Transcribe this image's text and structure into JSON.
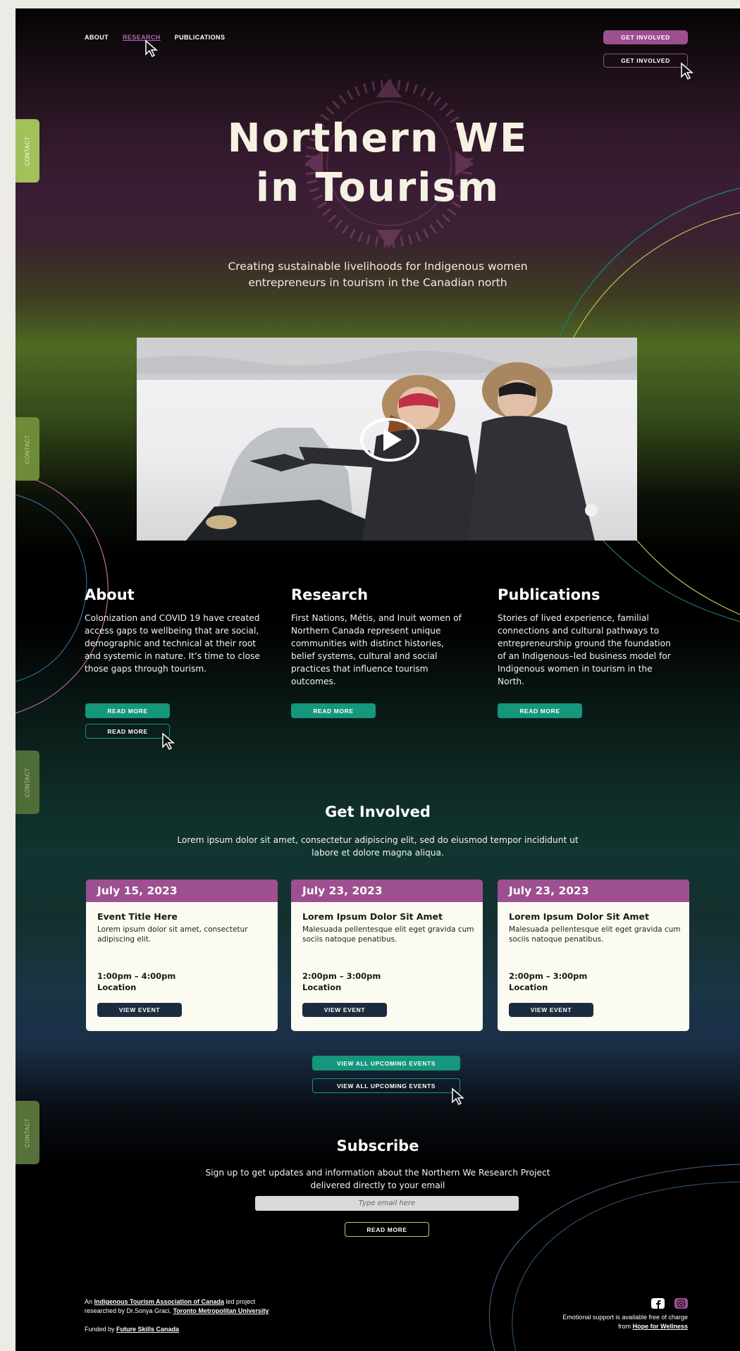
{
  "nav": {
    "items": [
      {
        "label": "ABOUT",
        "active": false
      },
      {
        "label": "RESEARCH",
        "active": true
      },
      {
        "label": "PUBLICATIONS",
        "active": false
      }
    ],
    "get_involved_label": "GET INVOLVED",
    "get_involved_outline_label": "GET INVOLVED"
  },
  "side_tabs": {
    "contact_1": "CONTACT",
    "contact_2": "CONTACT",
    "contact_3": "CONTACT",
    "contact_4": "CONTACT"
  },
  "hero": {
    "title_line1": "Northern WE",
    "title_line2": "in Tourism",
    "subtitle": "Creating sustainable livelihoods for Indigenous women entrepreneurs in tourism in the Canadian north"
  },
  "columns": [
    {
      "heading": "About",
      "text": "Colonization and COVID 19 have created access gaps to wellbeing that are social, demographic and technical at their root and systemic in nature. It’s time to close those gaps through tourism.",
      "button": "READ MORE",
      "button_outline": "READ MORE"
    },
    {
      "heading": "Research",
      "text": "First Nations, Métis, and Inuit women of Northern Canada represent unique communities with distinct histories, belief systems, cultural and social practices that influence tourism outcomes.",
      "button": "READ MORE"
    },
    {
      "heading": "Publications",
      "text": "Stories of lived experience, familial connections and cultural pathways to entrepreneurship ground the foundation of an Indigenous–led business model for Indigenous women in tourism in  the North.",
      "button": "READ MORE"
    }
  ],
  "get_involved": {
    "title": "Get Involved",
    "text": "Lorem ipsum dolor sit amet, consectetur adipiscing elit, sed do eiusmod tempor incididunt ut labore et dolore magna aliqua.",
    "events": [
      {
        "date": "July 15, 2023",
        "title": "Event Title Here",
        "desc": "Lorem ipsum dolor sit amet, consectetur adipiscing elit.",
        "time": "1:00pm – 4:00pm",
        "location": "Location",
        "button": "VIEW EVENT"
      },
      {
        "date": "July 23, 2023",
        "title": "Lorem Ipsum Dolor Sit Amet",
        "desc": "Malesuada pellentesque elit eget gravida cum sociis natoque penatibus.",
        "time": "2:00pm – 3:00pm",
        "location": "Location",
        "button": "VIEW EVENT"
      },
      {
        "date": "July 23, 2023",
        "title": "Lorem Ipsum Dolor Sit Amet",
        "desc": "Malesuada pellentesque elit eget gravida cum sociis natoque penatibus.",
        "time": "2:00pm – 3:00pm",
        "location": "Location",
        "button": "VIEW EVENT"
      }
    ],
    "view_all": "VIEW ALL UPCOMING EVENTS",
    "view_all_outline": "VIEW ALL UPCOMING EVENTS"
  },
  "subscribe": {
    "title": "Subscribe",
    "text": "Sign up to get updates and information about the Northern We Research Project delivered directly to your email",
    "placeholder": "Type email here",
    "button": "READ MORE"
  },
  "footer": {
    "line1_prefix": "An ",
    "itac_link": "Indigenous Tourism Association of Canada",
    "line1_suffix": " led project",
    "line2_prefix": "researched by Dr.Sonya Graci, ",
    "tmu_link": "Toronto Metropolitan University",
    "funded_prefix": "Funded by ",
    "funded_link": "Future Skills Canada",
    "support_text": "Emotional support is available free of charge",
    "support_from": "from ",
    "support_link": "Hope for Wellness"
  },
  "icons": {
    "facebook": "facebook-icon",
    "instagram": "instagram-icon",
    "play": "play-icon",
    "cursor": "pointer-cursor-icon"
  },
  "colors": {
    "accent_purple": "#9d4f90",
    "accent_teal": "#14977c",
    "accent_green": "#a8c25a",
    "card_bg": "#fcfbf1",
    "button_navy": "#1d2b3e"
  }
}
